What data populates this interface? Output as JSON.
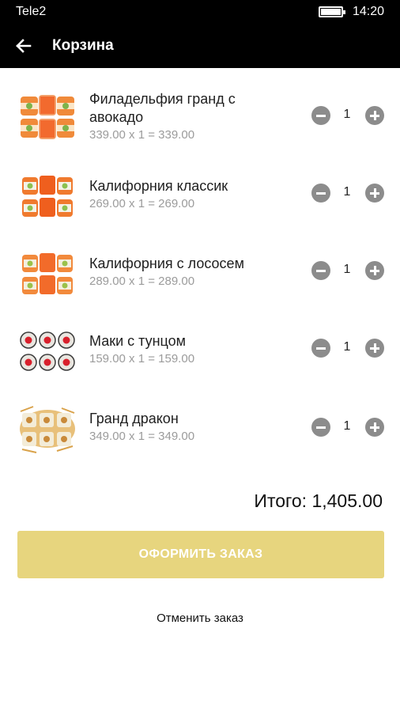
{
  "status_bar": {
    "carrier": "Tele2",
    "time": "14:20"
  },
  "app_bar": {
    "title": "Корзина",
    "back_icon": "arrow-left-icon"
  },
  "items": [
    {
      "name": "Филадельфия гранд с авокадо",
      "price_line": "339.00 x 1 = 339.00",
      "qty": "1",
      "image": "philadelphia-roll-image"
    },
    {
      "name": "Калифорния классик",
      "price_line": "269.00 x 1 = 269.00",
      "qty": "1",
      "image": "california-classic-roll-image"
    },
    {
      "name": "Калифорния с лососем",
      "price_line": "289.00 x 1 = 289.00",
      "qty": "1",
      "image": "california-salmon-roll-image"
    },
    {
      "name": "Маки с тунцом",
      "price_line": "159.00 x 1 = 159.00",
      "qty": "1",
      "image": "tuna-maki-image"
    },
    {
      "name": "Гранд дракон",
      "price_line": "349.00 x 1 = 349.00",
      "qty": "1",
      "image": "grand-dragon-roll-image"
    }
  ],
  "total": "Итого: 1,405.00",
  "order_button": "ОФОРМИТЬ ЗАКАЗ",
  "cancel_link": "Отменить заказ",
  "colors": {
    "bar": "#000000",
    "accent": "#e7d57e",
    "stepper": "#8c8c8c",
    "price_text": "#9b9b9b"
  }
}
